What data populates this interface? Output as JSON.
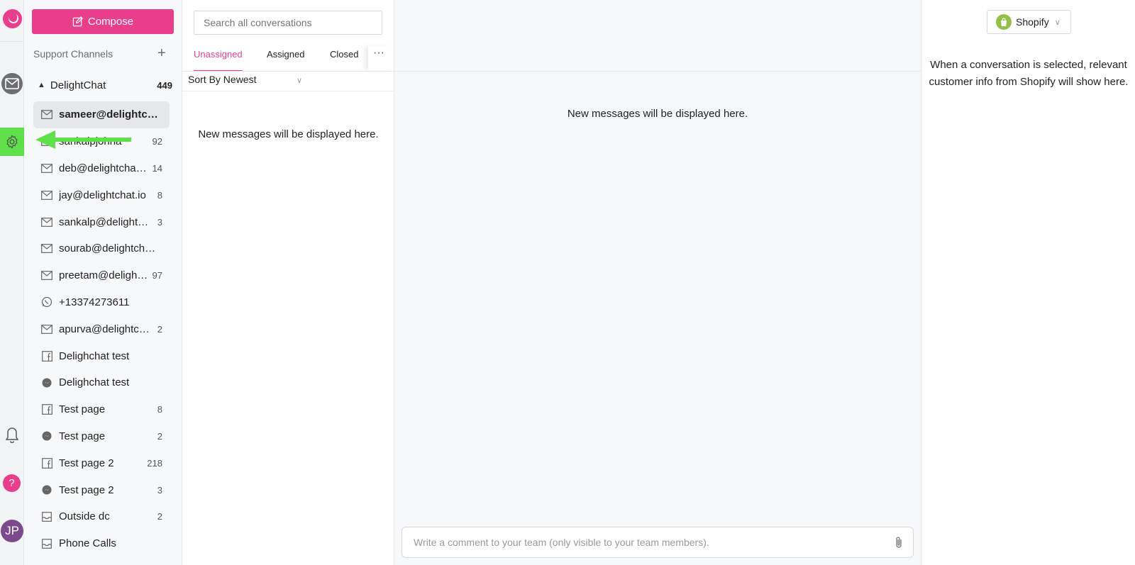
{
  "compose": {
    "label": "Compose"
  },
  "sidebar": {
    "section_title": "Support Channels",
    "add_symbol": "+",
    "group": {
      "name": "DelightChat",
      "count": "449"
    },
    "channels": [
      {
        "name": "sameer@delightchat.io",
        "count": "",
        "icon": "mail-icon",
        "active": true
      },
      {
        "name": "sankalpjohna",
        "count": "92",
        "icon": "mail-icon"
      },
      {
        "name": "deb@delightchat.io",
        "count": "14",
        "icon": "mail-icon"
      },
      {
        "name": "jay@delightchat.io",
        "count": "8",
        "icon": "mail-icon"
      },
      {
        "name": "sankalp@delightchat.io",
        "count": "3",
        "icon": "mail-icon"
      },
      {
        "name": "sourab@delightchat.io",
        "count": "",
        "icon": "mail-icon"
      },
      {
        "name": "preetam@delightchat.io",
        "count": "97",
        "icon": "mail-icon"
      },
      {
        "name": "+13374273611",
        "count": "",
        "icon": "whatsapp-icon"
      },
      {
        "name": "apurva@delightchat.io",
        "count": "2",
        "icon": "mail-icon"
      },
      {
        "name": "Delighchat test",
        "count": "",
        "icon": "facebook-icon"
      },
      {
        "name": "Delighchat test",
        "count": "",
        "icon": "messenger-icon"
      },
      {
        "name": "Test page",
        "count": "8",
        "icon": "facebook-icon"
      },
      {
        "name": "Test page",
        "count": "2",
        "icon": "messenger-icon"
      },
      {
        "name": "Test page 2",
        "count": "218",
        "icon": "facebook-icon"
      },
      {
        "name": "Test page 2",
        "count": "3",
        "icon": "messenger-icon"
      },
      {
        "name": "Outside dc",
        "count": "2",
        "icon": "inbox-icon"
      },
      {
        "name": "Phone Calls",
        "count": "",
        "icon": "inbox-icon"
      }
    ]
  },
  "conversations": {
    "search_placeholder": "Search all conversations",
    "tabs": [
      "Unassigned",
      "Assigned",
      "Closed"
    ],
    "active_tab": "Unassigned",
    "more_label": "···",
    "sort_label": "Sort By Newest",
    "empty_text": "New messages will be displayed here."
  },
  "main": {
    "empty_text": "New messages will be displayed here.",
    "comment_placeholder": "Write a comment to your team (only visible to your team members)."
  },
  "right_panel": {
    "integration": "Shopify",
    "info_text": "When a conversation is selected, relevant customer info from Shopify will show here."
  },
  "rail": {
    "help_label": "?",
    "avatar_initials": "JP"
  },
  "colors": {
    "accent": "#e83e8c",
    "highlight": "#5fe04a",
    "shopify": "#95bf47"
  }
}
